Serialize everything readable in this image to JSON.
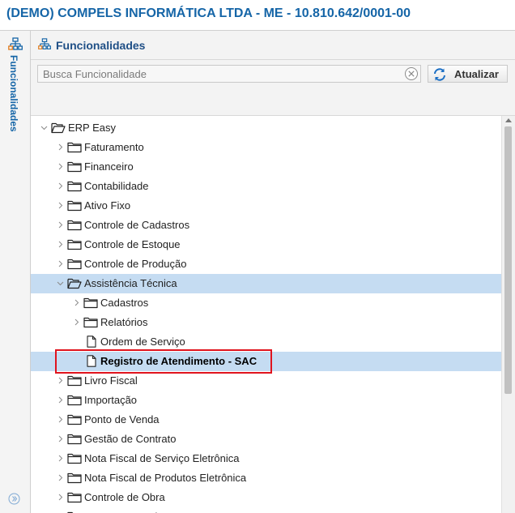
{
  "window": {
    "title": "(DEMO) COMPELS INFORMÁTICA LTDA - ME - 10.810.642/0001-00"
  },
  "sidebar": {
    "label": "Funcionalidades"
  },
  "panel": {
    "title": "Funcionalidades"
  },
  "search": {
    "placeholder": "Busca Funcionalidade",
    "value": ""
  },
  "toolbar": {
    "refresh_label": "Atualizar"
  },
  "colors": {
    "accent": "#1565a7",
    "selection": "#c5dcf2",
    "highlight_border": "#e0141e"
  },
  "tree": {
    "items": [
      {
        "label": "ERP Easy",
        "level": 0,
        "expanded": true,
        "type": "folder"
      },
      {
        "label": "Faturamento",
        "level": 1,
        "expanded": false,
        "type": "folder"
      },
      {
        "label": "Financeiro",
        "level": 1,
        "expanded": false,
        "type": "folder"
      },
      {
        "label": "Contabilidade",
        "level": 1,
        "expanded": false,
        "type": "folder"
      },
      {
        "label": "Ativo Fixo",
        "level": 1,
        "expanded": false,
        "type": "folder"
      },
      {
        "label": "Controle de Cadastros",
        "level": 1,
        "expanded": false,
        "type": "folder"
      },
      {
        "label": "Controle de Estoque",
        "level": 1,
        "expanded": false,
        "type": "folder"
      },
      {
        "label": "Controle de Produção",
        "level": 1,
        "expanded": false,
        "type": "folder"
      },
      {
        "label": "Assistência Técnica",
        "level": 1,
        "expanded": true,
        "type": "folder",
        "selected": true
      },
      {
        "label": "Cadastros",
        "level": 2,
        "expanded": false,
        "type": "folder"
      },
      {
        "label": "Relatórios",
        "level": 2,
        "expanded": false,
        "type": "folder"
      },
      {
        "label": "Ordem de Serviço",
        "level": 2,
        "type": "file"
      },
      {
        "label": "Registro de Atendimento - SAC",
        "level": 2,
        "type": "file",
        "selected": true,
        "bold": true,
        "highlighted": true
      },
      {
        "label": "Livro Fiscal",
        "level": 1,
        "expanded": false,
        "type": "folder"
      },
      {
        "label": "Importação",
        "level": 1,
        "expanded": false,
        "type": "folder"
      },
      {
        "label": "Ponto de Venda",
        "level": 1,
        "expanded": false,
        "type": "folder"
      },
      {
        "label": "Gestão de Contrato",
        "level": 1,
        "expanded": false,
        "type": "folder"
      },
      {
        "label": "Nota Fiscal de Serviço Eletrônica",
        "level": 1,
        "expanded": false,
        "type": "folder"
      },
      {
        "label": "Nota Fiscal de Produtos Eletrônica",
        "level": 1,
        "expanded": false,
        "type": "folder"
      },
      {
        "label": "Controle de Obra",
        "level": 1,
        "expanded": false,
        "type": "folder"
      },
      {
        "label": "Compra e Venda",
        "level": 1,
        "expanded": false,
        "type": "folder"
      }
    ]
  }
}
